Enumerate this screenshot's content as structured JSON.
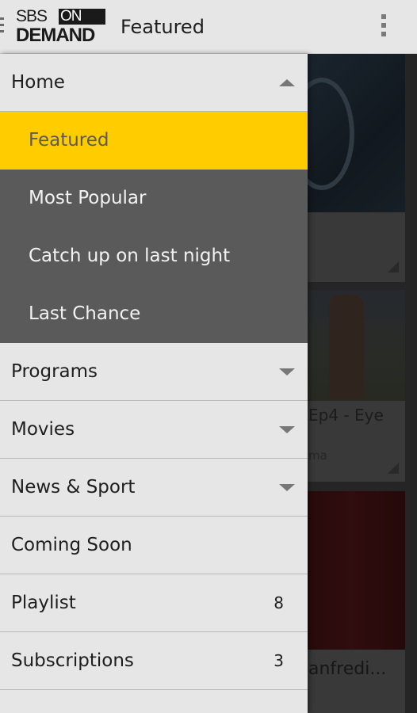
{
  "app": {
    "logo_text": "SBS ON DEMAND",
    "title": "Featured",
    "icons": {
      "drawer": "drawer-indicator-icon",
      "overflow": "overflow-menu-icon"
    }
  },
  "drawer": {
    "items": [
      {
        "label": "Home",
        "expanded": true,
        "icon": "chevron-up-icon"
      },
      {
        "label": "Featured",
        "selected": true
      },
      {
        "label": "Most Popular"
      },
      {
        "label": "Catch up on last night"
      },
      {
        "label": "Last Chance"
      },
      {
        "label": "Programs",
        "icon": "chevron-down-icon"
      },
      {
        "label": "Movies",
        "icon": "chevron-down-icon"
      },
      {
        "label": "News & Sport",
        "icon": "chevron-down-icon"
      },
      {
        "label": "Coming Soon"
      },
      {
        "label": "Playlist",
        "count": "8"
      },
      {
        "label": "Subscriptions",
        "count": "3"
      }
    ]
  },
  "background_cards": [
    {
      "title": ""
    },
    {
      "title": "Ep4 - Eye",
      "subtitle": "ma"
    },
    {
      "title": "anfredi..."
    }
  ],
  "colors": {
    "accent": "#ffcc00",
    "submenu_bg": "#5a5a5a",
    "drawer_bg": "#e6e6e6"
  }
}
